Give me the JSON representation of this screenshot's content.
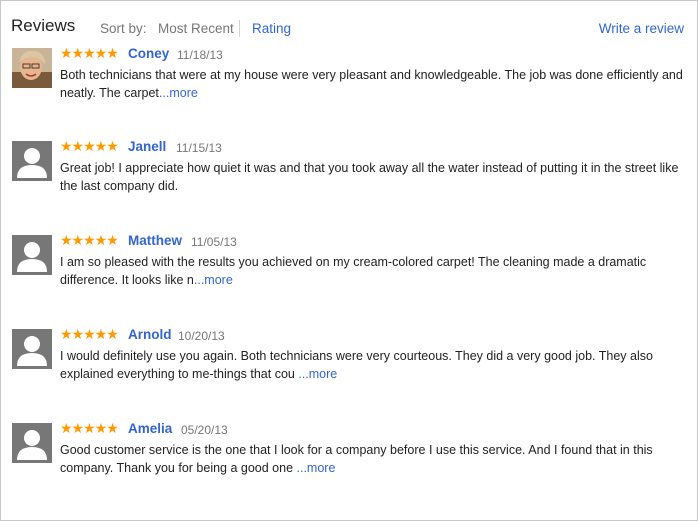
{
  "header": {
    "title": "Reviews",
    "sort_label": "Sort by:",
    "sort_options": [
      "Most Recent",
      "Rating"
    ],
    "write_review": "Write a review"
  },
  "reviews": [
    {
      "stars": "★★★★★",
      "rating": 5,
      "author": "Coney",
      "date": "11/18/13",
      "text": "Both technicians that were at my house were very pleasant and knowledgeable. The job was done efficiently and neatly. The carpet",
      "more": "...more",
      "avatar": "user-photo"
    },
    {
      "stars": "★★★★★",
      "rating": 5,
      "author": "Janell",
      "date": "11/15/13",
      "text": "Great job! I appreciate how quiet it was and that you took away all the water instead of putting it in the street like the last company did.",
      "more": "",
      "avatar": "default-user-icon"
    },
    {
      "stars": "★★★★★",
      "rating": 5,
      "author": "Matthew",
      "date": "11/05/13",
      "text": "I am so pleased with the results you achieved on my cream-colored carpet! The cleaning made a dramatic difference. It looks like n",
      "more": "...more",
      "avatar": "default-user-icon"
    },
    {
      "stars": "★★★★★",
      "rating": 5,
      "author": "Arnold",
      "date": "10/20/13",
      "text": "I would definitely use you again. Both technicians were very courteous. They did a very good job. They also explained everything to me-things that cou ",
      "more": "...more",
      "avatar": "default-user-icon"
    },
    {
      "stars": "★★★★★",
      "rating": 5,
      "author": "Amelia",
      "date": "05/20/13",
      "text": "Good customer service is the one that I look for a company before I use this service. And I found that in this company. Thank you for being a good one ",
      "more": "...more",
      "avatar": "default-user-icon"
    }
  ],
  "colors": {
    "link": "#3366cc",
    "star": "#ff9900",
    "muted": "#777777",
    "text": "#222222"
  }
}
